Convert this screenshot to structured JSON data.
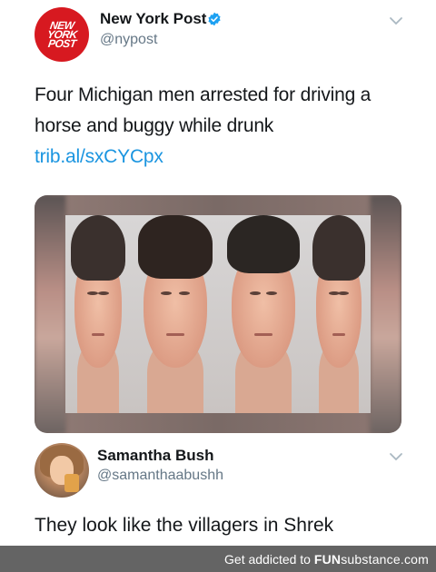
{
  "tweet": {
    "author_name": "New York Post",
    "author_handle": "@nypost",
    "avatar_text": [
      "NEW",
      "YORK",
      "POST"
    ],
    "text": "Four Michigan men arrested for driving a horse and buggy while drunk ",
    "link": "trib.al/sxCYCpx",
    "verified": true,
    "accent_color": "#d71920",
    "link_color": "#1b95e0"
  },
  "reply": {
    "author_name": "Samantha Bush",
    "author_handle": "@samanthaabushh",
    "text": "They look like the villagers in Shrek"
  },
  "footer": {
    "prefix": "Get addicted to",
    "brand_bold": "FUN",
    "brand_rest": "substance",
    "brand_suffix": ".com"
  },
  "icons": {
    "verified": "verified-badge-icon",
    "menu": "chevron-down-icon"
  }
}
